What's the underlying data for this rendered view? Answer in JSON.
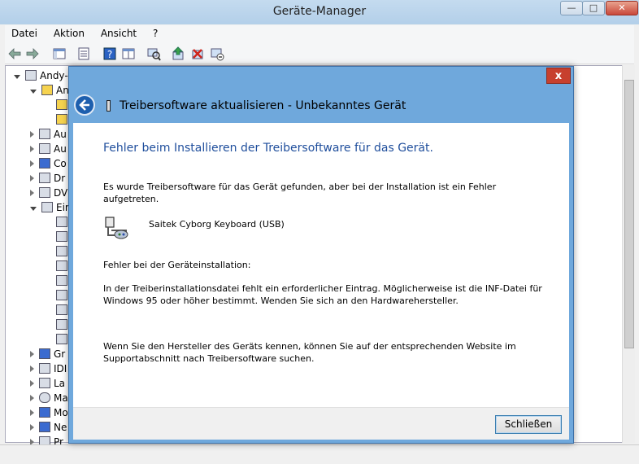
{
  "window": {
    "title": "Geräte-Manager",
    "controls": {
      "minimize": "—",
      "maximize": "□",
      "close": "✕"
    }
  },
  "menu": [
    "Datei",
    "Aktion",
    "Ansicht",
    "?"
  ],
  "tree": {
    "root": "Andy-",
    "items": [
      {
        "label": "An",
        "icon": "warning-device-icon"
      },
      {
        "label": "",
        "icon": "warning-device-icon"
      },
      {
        "label": "",
        "icon": "warning-device-icon"
      },
      {
        "label": "Au",
        "icon": "speaker-icon"
      },
      {
        "label": "Au",
        "icon": "speaker-icon"
      },
      {
        "label": "Co",
        "icon": "computer-icon"
      },
      {
        "label": "Dr",
        "icon": "printer-icon"
      },
      {
        "label": "DV",
        "icon": "dvd-drive-icon"
      },
      {
        "label": "Ein",
        "icon": "input-device-icon"
      },
      {
        "label": "Gr",
        "icon": "display-adapter-icon"
      },
      {
        "label": "IDI",
        "icon": "ide-controller-icon"
      },
      {
        "label": "La",
        "icon": "drive-icon"
      },
      {
        "label": "Ma",
        "icon": "mouse-icon"
      },
      {
        "label": "Mo",
        "icon": "monitor-icon"
      },
      {
        "label": "Ne",
        "icon": "network-icon"
      },
      {
        "label": "Pr",
        "icon": "processor-icon"
      }
    ]
  },
  "dialog": {
    "close_label": "x",
    "title": "Treibersoftware aktualisieren - Unbekanntes Gerät",
    "heading": "Fehler beim Installieren der Treibersoftware für das Gerät.",
    "intro": "Es wurde Treibersoftware für das Gerät gefunden, aber bei der Installation ist ein Fehler aufgetreten.",
    "device_name": "Saitek Cyborg Keyboard (USB)",
    "error_label": "Fehler bei der Geräteinstallation:",
    "error_detail": "In der Treiberinstallationsdatei fehlt ein erforderlicher Eintrag. Möglicherweise ist die INF-Datei für Windows 95 oder höher bestimmt. Wenden Sie sich an den Hardwarehersteller.",
    "hint": "Wenn Sie den Hersteller des Geräts kennen, können Sie auf der entsprechenden Website im Supportabschnitt nach Treibersoftware suchen.",
    "button_close": "Schließen"
  },
  "colors": {
    "heading": "#1f4e9c",
    "frame": "#6fa8dc",
    "close_red": "#c7402e"
  }
}
